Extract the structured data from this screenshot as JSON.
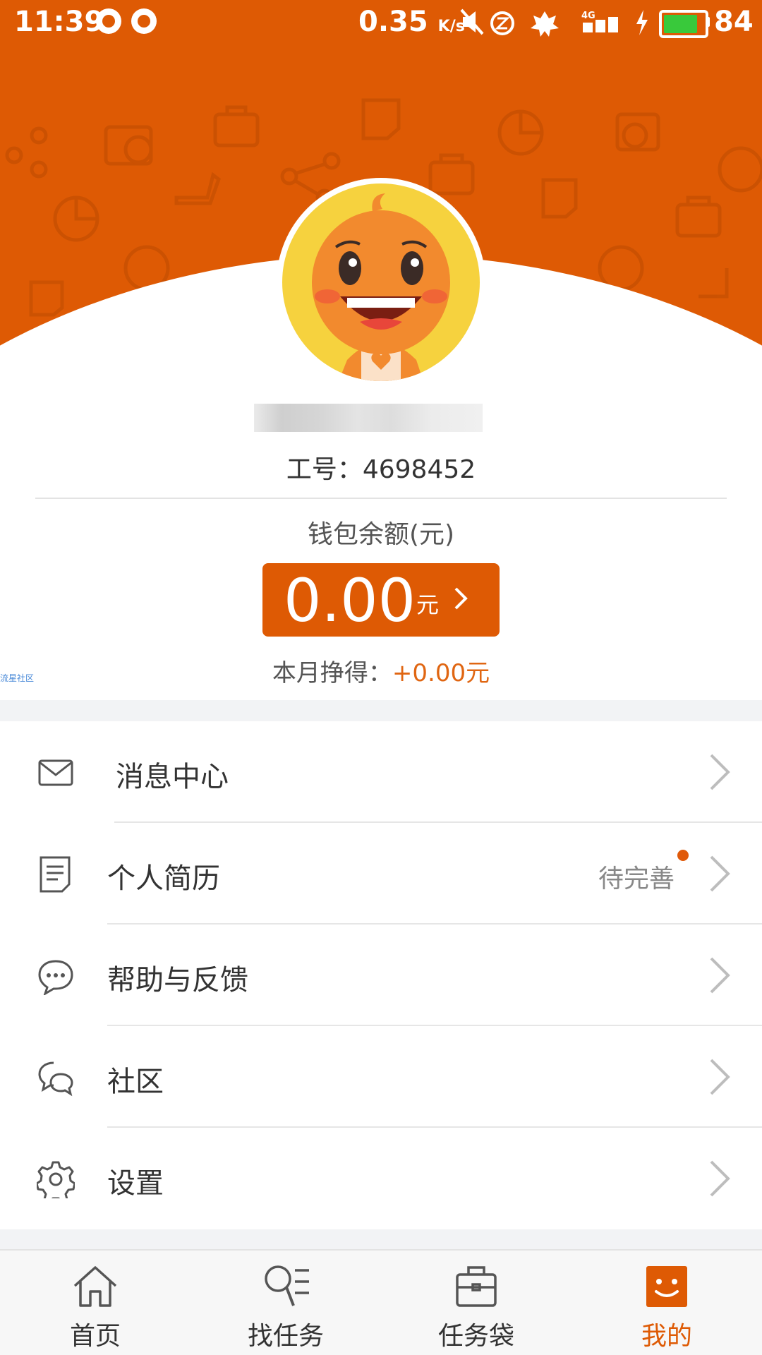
{
  "status_bar": {
    "time": "11:39",
    "net_speed": "0.35",
    "net_unit": "K/s",
    "battery_level": "84",
    "battery_fill_fraction": 0.84,
    "icons": [
      "sync-icon",
      "app-notify-icon",
      "mute-icon",
      "alarm-icon",
      "app-logo-icon",
      "signal-4g-icon",
      "charging-icon",
      "battery-icon"
    ]
  },
  "profile": {
    "avatar": "mascot-avatar",
    "staff_id": "工号：4698452",
    "wallet_label": "钱包余额(元)",
    "balance": "0.00",
    "balance_unit": "元",
    "month_earn_label": "本月挣得：",
    "month_earn_value": "+0.00元",
    "tiny_link": "流星社区"
  },
  "menu": {
    "items": [
      {
        "label": "消息中心",
        "icon": "mail-icon"
      },
      {
        "label": "个人简历",
        "icon": "resume-icon",
        "status": "待完善"
      },
      {
        "label": "帮助与反馈",
        "icon": "chat-bubble-icon"
      },
      {
        "label": "社区",
        "icon": "community-icon"
      },
      {
        "label": "设置",
        "icon": "gear-icon"
      }
    ]
  },
  "tabbar": {
    "tabs": [
      {
        "label": "首页",
        "icon": "home-icon"
      },
      {
        "label": "找任务",
        "icon": "search-task-icon"
      },
      {
        "label": "任务袋",
        "icon": "briefcase-icon"
      },
      {
        "label": "我的",
        "icon": "smile-face-icon",
        "active": true
      }
    ]
  },
  "colors": {
    "brand": "#DE5A04",
    "earn_text": "#E06612",
    "avatar_bg": "#F6D23E"
  }
}
